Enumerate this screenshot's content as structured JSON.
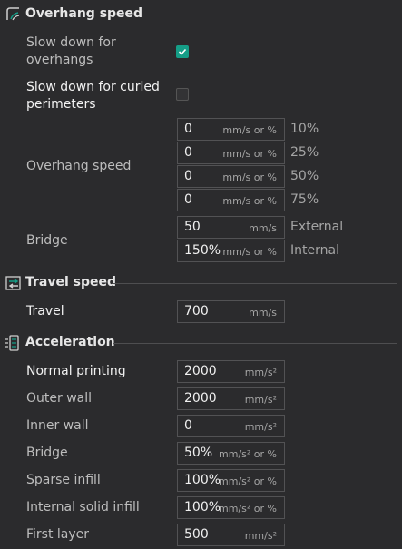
{
  "overhang": {
    "title": "Overhang speed",
    "slow_down_overhangs_label": "Slow down for overhangs",
    "slow_down_curled_label": "Slow down for curled perimeters",
    "overhang_speed_label": "Overhang speed",
    "fields": [
      {
        "value": "0",
        "unit": "mm/s or %",
        "side": "10%"
      },
      {
        "value": "0",
        "unit": "mm/s or %",
        "side": "25%"
      },
      {
        "value": "0",
        "unit": "mm/s or %",
        "side": "50%"
      },
      {
        "value": "0",
        "unit": "mm/s or %",
        "side": "75%"
      }
    ],
    "bridge_label": "Bridge",
    "bridge_fields": [
      {
        "value": "50",
        "unit": "mm/s",
        "side": "External"
      },
      {
        "value": "150%",
        "unit": "mm/s or %",
        "side": "Internal"
      }
    ],
    "slow_down_overhangs_checked": true,
    "slow_down_curled_checked": false
  },
  "travel": {
    "title": "Travel speed",
    "travel_label": "Travel",
    "travel_value": "700",
    "travel_unit": "mm/s"
  },
  "acceleration": {
    "title": "Acceleration",
    "rows": [
      {
        "label": "Normal printing",
        "value": "2000",
        "unit": "mm/s²"
      },
      {
        "label": "Outer wall",
        "value": "2000",
        "unit": "mm/s²"
      },
      {
        "label": "Inner wall",
        "value": "0",
        "unit": "mm/s²"
      },
      {
        "label": "Bridge",
        "value": "50%",
        "unit": "mm/s² or %"
      },
      {
        "label": "Sparse infill",
        "value": "100%",
        "unit": "mm/s² or %"
      },
      {
        "label": "Internal solid infill",
        "value": "100%",
        "unit": "mm/s² or %"
      },
      {
        "label": "First layer",
        "value": "500",
        "unit": "mm/s²"
      }
    ]
  },
  "colors": {
    "background": "#2b2b2d",
    "accent": "#159e87",
    "border": "#525254"
  }
}
